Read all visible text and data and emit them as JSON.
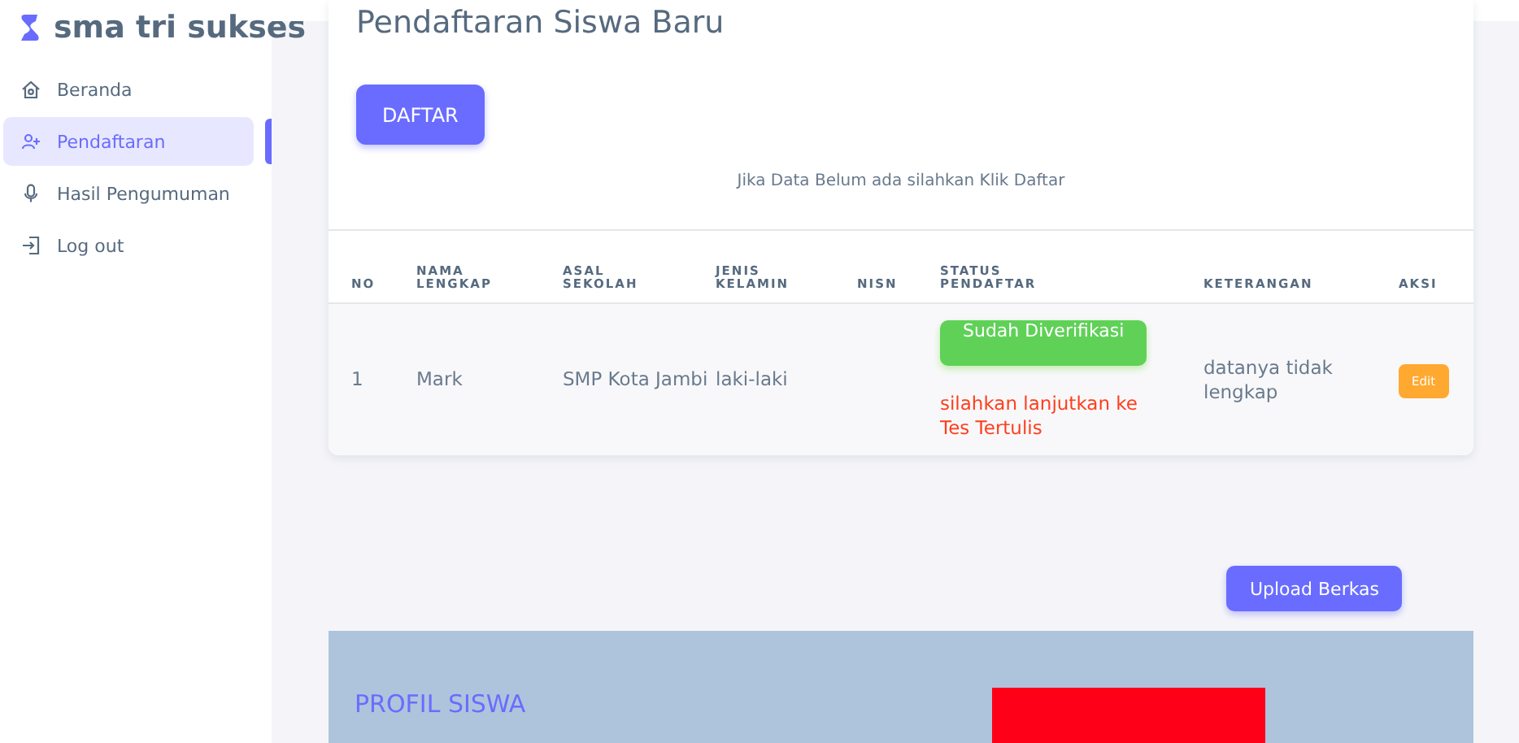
{
  "brand": {
    "name": "sma tri sukses"
  },
  "sidebar": {
    "items": [
      {
        "label": "Beranda",
        "selected": false
      },
      {
        "label": "Pendaftaran",
        "selected": true
      },
      {
        "label": "Hasil Pengumuman",
        "selected": false
      },
      {
        "label": "Log out",
        "selected": false
      }
    ]
  },
  "card": {
    "title": "Pendaftaran Siswa Baru",
    "register_button": "DAFTAR",
    "hint": "Jika Data Belum ada silahkan Klik Daftar"
  },
  "table": {
    "columns": [
      "NO",
      "NAMA LENGKAP",
      "ASAL SEKOLAH",
      "JENIS KELAMIN",
      "NISN",
      "STATUS PENDAFTAR",
      "KETERANGAN",
      "AKSI"
    ],
    "rows": [
      {
        "no": "1",
        "nama": "Mark",
        "asal": "SMP Kota Jambi",
        "jenis_kelamin": "laki-laki",
        "status": {
          "badge": "Sudah Diverifikasi",
          "note": "silahkan lanjutkan ke Tes Tertulis"
        },
        "keterangan": "datanya tidak lengkap",
        "action": "Edit"
      }
    ]
  },
  "upload_button": "Upload Berkas",
  "profile": {
    "title": "PROFIL SISWA"
  }
}
